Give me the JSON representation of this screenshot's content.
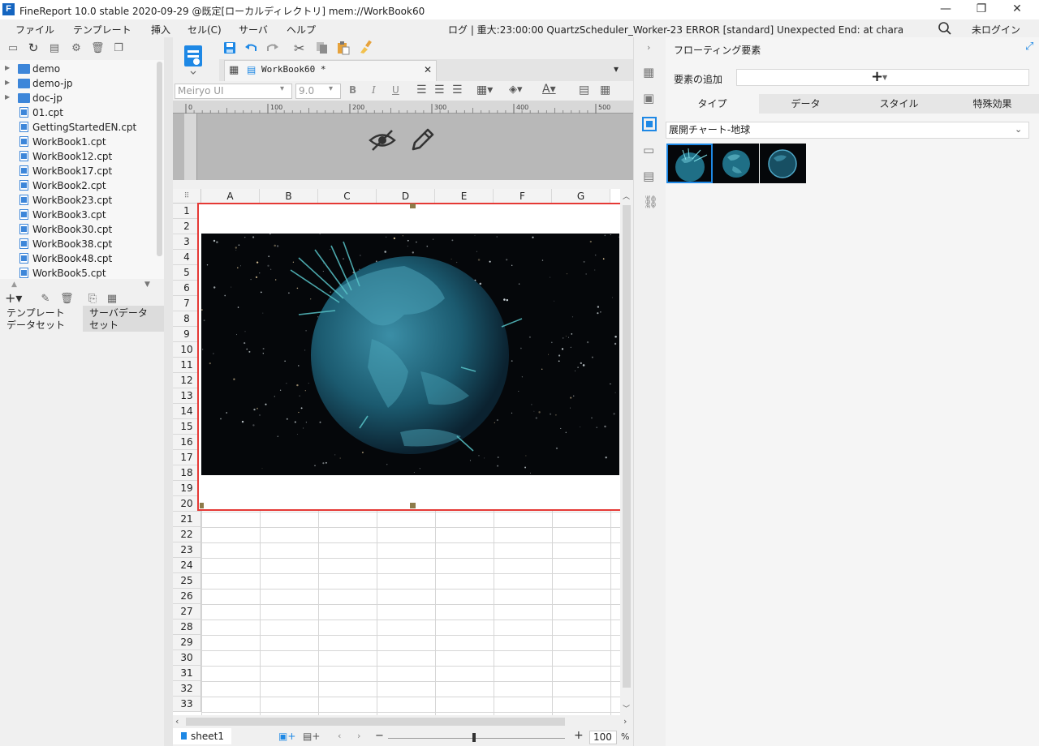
{
  "window": {
    "title": "FineReport 10.0 stable 2020-09-29 @既定[ローカルディレクトリ]   mem://WorkBook60",
    "minimize": "—",
    "restore": "❐",
    "close": "✕"
  },
  "menubar": {
    "items": [
      "ファイル",
      "テンプレート",
      "挿入",
      "セル(C)",
      "サーバ",
      "ヘルプ"
    ],
    "log": "ログ | 重大:23:00:00 QuartzScheduler_Worker-23 ERROR [standard] Unexpected End: at character 0 of",
    "login": "未ログイン"
  },
  "tree": {
    "items": [
      {
        "label": "demo",
        "type": "folder"
      },
      {
        "label": "demo-jp",
        "type": "folder"
      },
      {
        "label": "doc-jp",
        "type": "folder"
      },
      {
        "label": "01.cpt",
        "type": "file"
      },
      {
        "label": "GettingStartedEN.cpt",
        "type": "file"
      },
      {
        "label": "WorkBook1.cpt",
        "type": "file"
      },
      {
        "label": "WorkBook12.cpt",
        "type": "file"
      },
      {
        "label": "WorkBook17.cpt",
        "type": "file"
      },
      {
        "label": "WorkBook2.cpt",
        "type": "file"
      },
      {
        "label": "WorkBook23.cpt",
        "type": "file"
      },
      {
        "label": "WorkBook3.cpt",
        "type": "file"
      },
      {
        "label": "WorkBook30.cpt",
        "type": "file"
      },
      {
        "label": "WorkBook38.cpt",
        "type": "file"
      },
      {
        "label": "WorkBook48.cpt",
        "type": "file"
      },
      {
        "label": "WorkBook5.cpt",
        "type": "file"
      }
    ]
  },
  "bottom_tabs": {
    "template_dataset": "テンプレート\nデータセット",
    "server_dataset": "サーバデータ\nセット"
  },
  "editor": {
    "tab_label": "WorkBook60 *",
    "tab_close": "✕",
    "font_name": "Meiryo UI",
    "font_size": "9.0",
    "bold": "B",
    "italic": "I",
    "underline": "U",
    "ruler_ticks": [
      "0",
      "100",
      "200",
      "300",
      "400",
      "500"
    ]
  },
  "sheet": {
    "columns": [
      "A",
      "B",
      "C",
      "D",
      "E",
      "F",
      "G"
    ],
    "rows": [
      "1",
      "2",
      "3",
      "4",
      "5",
      "6",
      "7",
      "8",
      "9",
      "10",
      "11",
      "12",
      "13",
      "14",
      "15",
      "16",
      "17",
      "18",
      "19",
      "20",
      "21",
      "22",
      "23",
      "24",
      "25",
      "26",
      "27",
      "28",
      "29",
      "30",
      "31",
      "32",
      "33"
    ]
  },
  "status": {
    "sheet_tab": "sheet1",
    "zoom_minus": "−",
    "zoom_plus": "+",
    "zoom_value": "100",
    "zoom_unit": "%"
  },
  "right_panel": {
    "title": "フローティング要素",
    "add_label": "要素の追加",
    "add_button": "+",
    "tabs": [
      "タイプ",
      "データ",
      "スタイル",
      "特殊効果"
    ],
    "active_tab": 0,
    "chart_type": "展開チャート-地球",
    "thumbnails": [
      "globe-variant-1",
      "globe-variant-2",
      "globe-variant-3"
    ]
  },
  "colors": {
    "accent": "#1565c0",
    "selection": "#e53935",
    "folder": "#3d86d9",
    "globe": "#1f6f86"
  }
}
